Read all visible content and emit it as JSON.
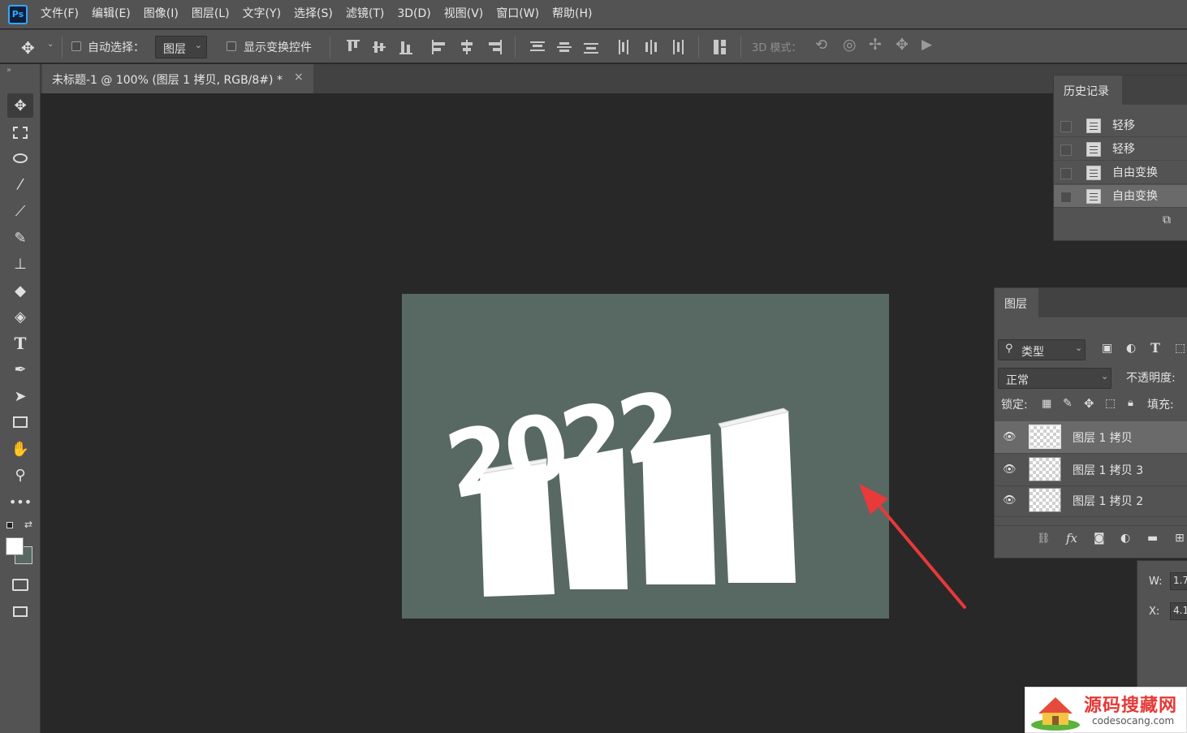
{
  "app": {
    "logo_text": "Ps"
  },
  "menu": [
    "文件(F)",
    "编辑(E)",
    "图像(I)",
    "图层(L)",
    "文字(Y)",
    "选择(S)",
    "滤镜(T)",
    "3D(D)",
    "视图(V)",
    "窗口(W)",
    "帮助(H)"
  ],
  "options": {
    "auto_select_label": "自动选择：",
    "auto_select_value": "图层",
    "show_transform_label": "显示变换控件",
    "mode_3d_label": "3D 模式："
  },
  "document": {
    "tab_title": "未标题-1 @ 100% (图层 1 拷贝, RGB/8#) *",
    "close_glyph": "×"
  },
  "canvas": {
    "text": "2022",
    "bg_color": "#586863"
  },
  "history": {
    "title": "历史记录",
    "items": [
      "轻移",
      "轻移",
      "自由变换",
      "自由变换"
    ]
  },
  "layers": {
    "title": "图层",
    "filter_label": "类型",
    "blend_mode": "正常",
    "opacity_label": "不透明度:",
    "lock_label": "锁定:",
    "fill_label": "填充:",
    "items": [
      "图层 1 拷贝",
      "图层 1 拷贝 3",
      "图层 1 拷贝 2"
    ]
  },
  "properties": {
    "w_label": "W:",
    "w_value": "1.7",
    "x_label": "X:",
    "x_value": "4.1"
  },
  "watermark": {
    "title": "源码搜藏网",
    "url": "codesocang.com"
  },
  "colors": {
    "annotation_arrow": "#e8393b",
    "accent": "#31a8ff"
  }
}
